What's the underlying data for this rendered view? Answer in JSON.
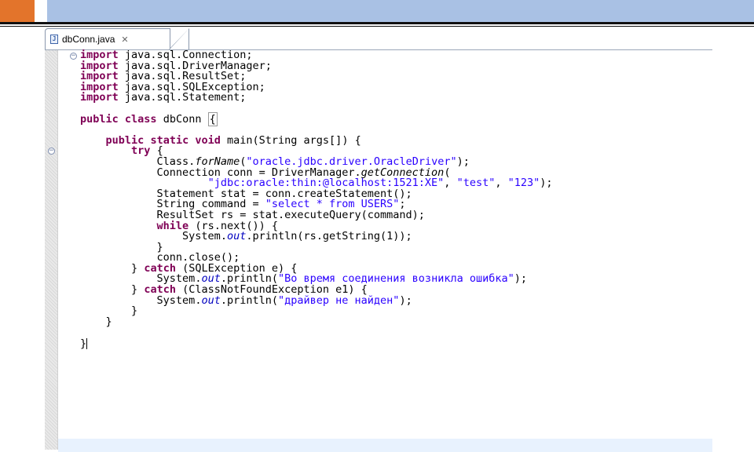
{
  "editor": {
    "tab": {
      "filename": "dbConn.java",
      "close": "✕",
      "icon_label": "J"
    },
    "code": {
      "import_kw": "import",
      "imports": [
        "java.sql.Connection;",
        "java.sql.DriverManager;",
        "java.sql.ResultSet;",
        "java.sql.SQLException;",
        "java.sql.Statement;"
      ],
      "public_kw": "public",
      "class_kw": "class",
      "class_name": "dbConn",
      "open_brace": "{",
      "static_kw": "static",
      "void_kw": "void",
      "main_sig": "main(String args[]) {",
      "try_kw": "try",
      "class_call": "Class.",
      "forName": "forName",
      "driver_str": "\"oracle.jdbc.driver.OracleDriver\"",
      "paren_close_semi": ");",
      "conn_decl": "Connection conn = DriverManager.",
      "getConnection": "getConnection",
      "open_paren": "(",
      "url_str": "\"jdbc:oracle:thin:@localhost:1521:XE\"",
      "user_str": "\"test\"",
      "pass_str": "\"123\"",
      "comma": ", ",
      "stat_decl": "Statement stat = conn.createStatement();",
      "cmd_decl": "String command = ",
      "cmd_str": "\"select * from USERS\"",
      "semi": ";",
      "rs_decl": "ResultSet rs = stat.executeQuery(command);",
      "while_kw": "while",
      "while_cond": " (rs.next()) {",
      "system": "System.",
      "out": "out",
      "println_rs": ".println(rs.getString(1));",
      "close_brace": "}",
      "conn_close": "conn.close();",
      "catch_kw": "catch",
      "catch1": " (SQLException e) {",
      "println_open": ".println(",
      "err1_str": "\"Во время соединения возникла ошибка\"",
      "catch2": " (ClassNotFoundException e1) {",
      "err2_str": "\"драйвер не найден\"",
      "final_brace": "}"
    }
  }
}
